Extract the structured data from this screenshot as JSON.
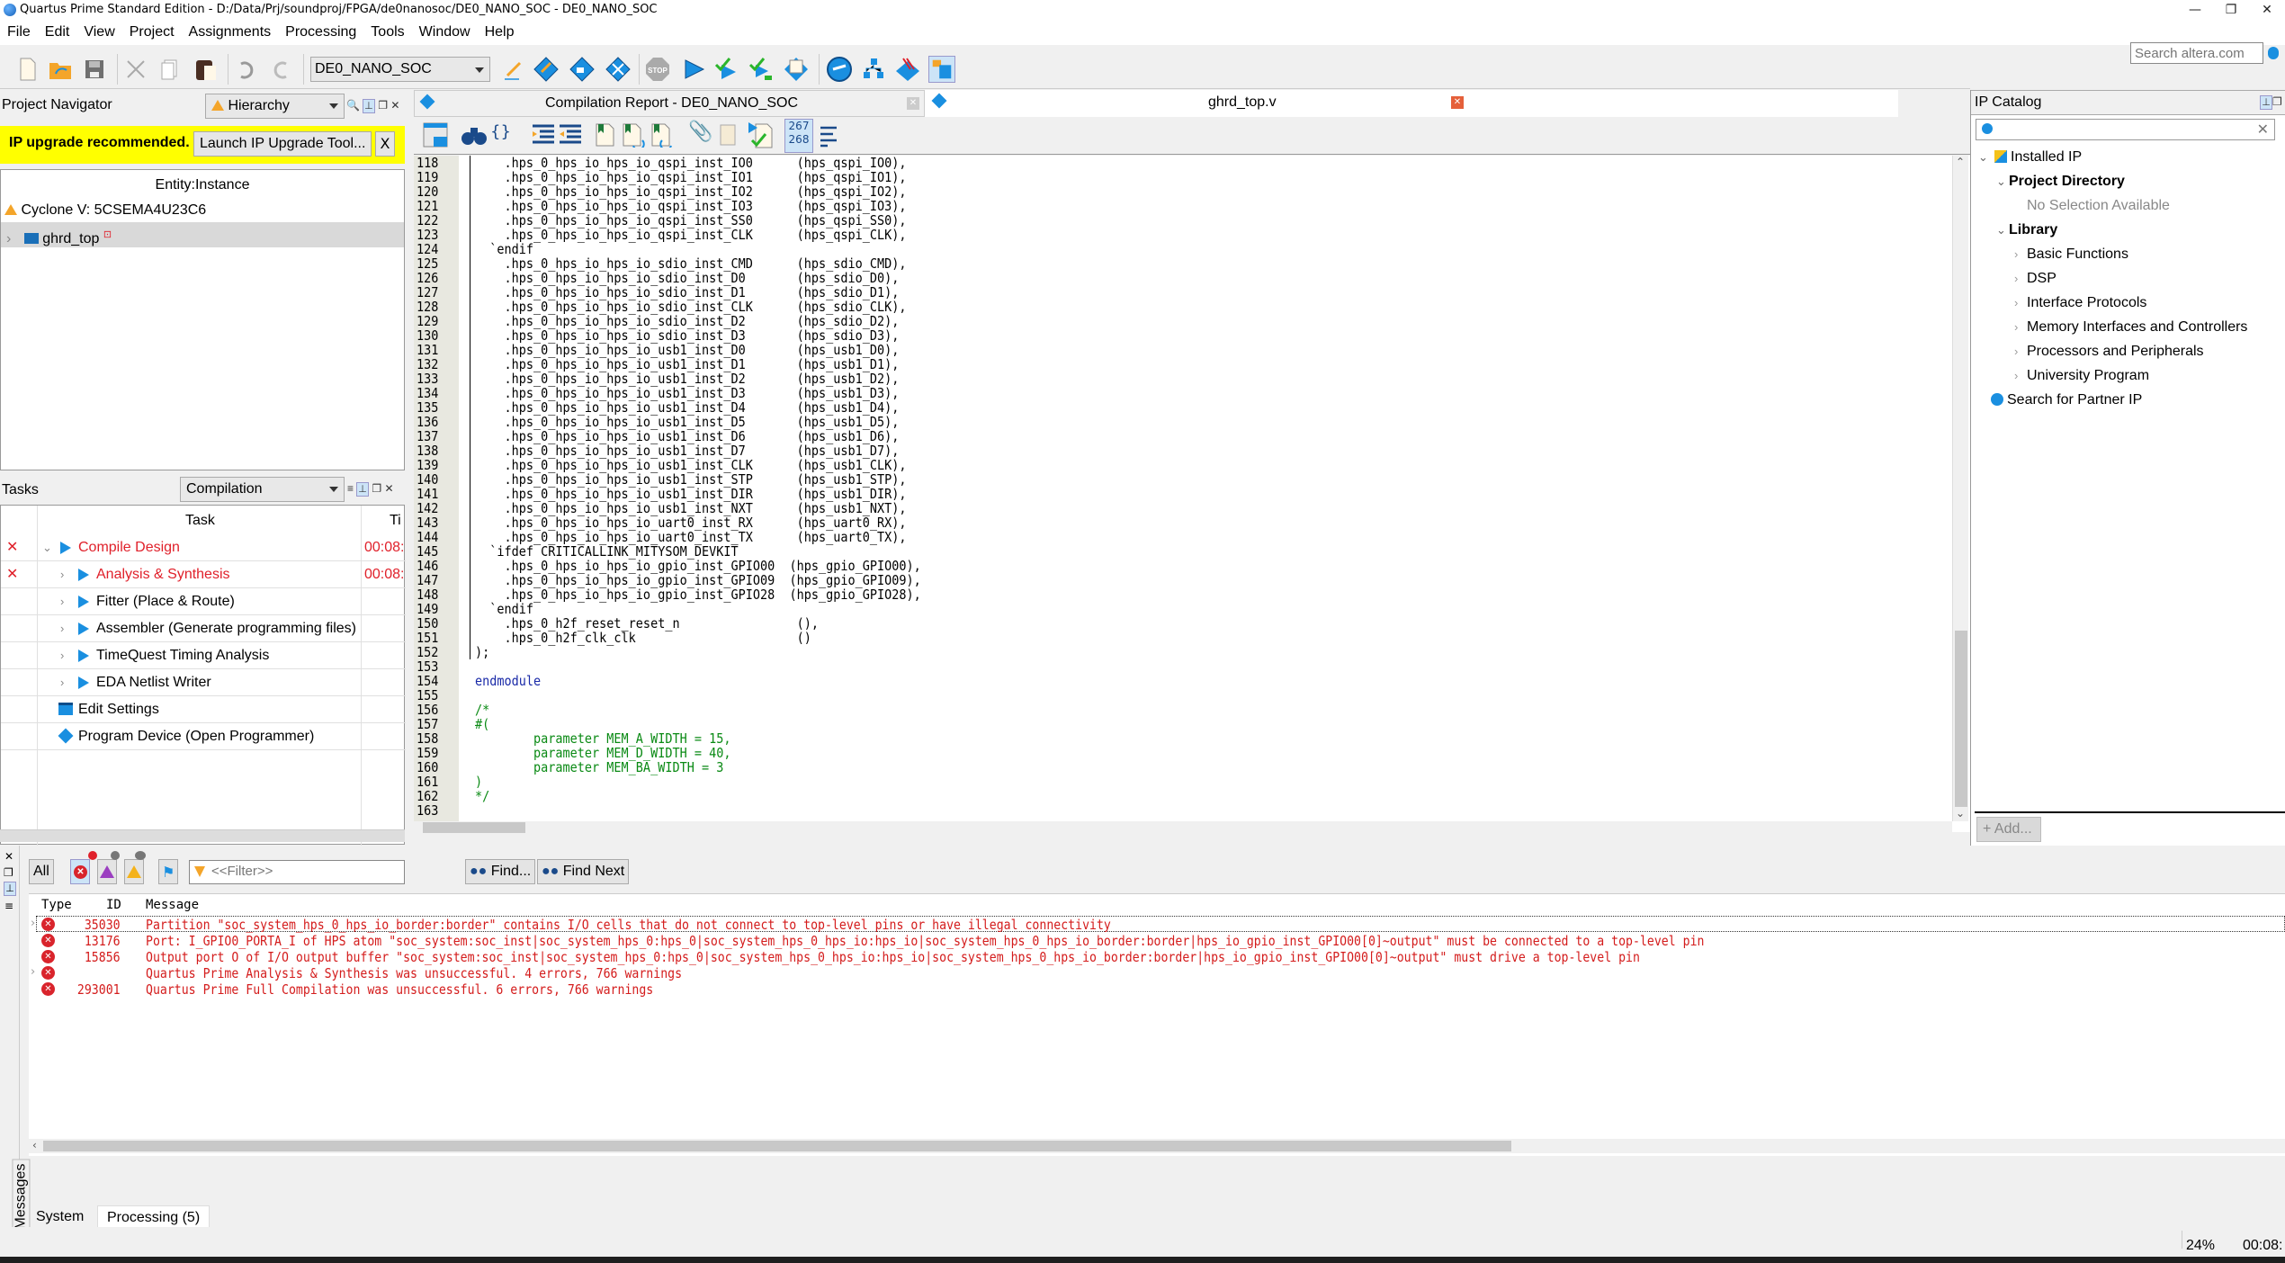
{
  "window": {
    "title": "Quartus Prime Standard Edition - D:/Data/Prj/soundproj/FPGA/de0nanosoc/DE0_NANO_SOC - DE0_NANO_SOC",
    "minimize": "—",
    "restore": "❐",
    "close": "✕"
  },
  "menu": [
    "File",
    "Edit",
    "View",
    "Project",
    "Assignments",
    "Processing",
    "Tools",
    "Window",
    "Help"
  ],
  "search_altera": {
    "placeholder": "Search altera.com"
  },
  "toolbar": {
    "project_selector": "DE0_NANO_SOC",
    "stop_label": "STOP",
    "line_counter_top": "267",
    "line_counter_bottom": "268"
  },
  "project_navigator": {
    "title": "Project Navigator",
    "view": "Hierarchy",
    "ip_banner": {
      "text": "IP upgrade recommended.",
      "button": "Launch IP Upgrade Tool...",
      "dismiss": "X"
    },
    "column_header": "Entity:Instance",
    "device": "Cyclone V: 5CSEMA4U23C6",
    "top_entity": "ghrd_top"
  },
  "tasks": {
    "title": "Tasks",
    "flow": "Compilation",
    "column_task": "Task",
    "column_time": "Ti",
    "items": [
      {
        "label": "Compile Design",
        "status": "error",
        "time": "00:08:",
        "level": 0,
        "expanded": true,
        "icon": "play-icon"
      },
      {
        "label": "Analysis & Synthesis",
        "status": "error",
        "time": "00:08:",
        "level": 1,
        "expanded": false,
        "icon": "play-icon"
      },
      {
        "label": "Fitter (Place & Route)",
        "status": "",
        "time": "",
        "level": 1,
        "expanded": false,
        "icon": "play-icon"
      },
      {
        "label": "Assembler (Generate programming files)",
        "status": "",
        "time": "",
        "level": 1,
        "expanded": false,
        "icon": "play-icon"
      },
      {
        "label": "TimeQuest Timing Analysis",
        "status": "",
        "time": "",
        "level": 1,
        "expanded": false,
        "icon": "play-icon"
      },
      {
        "label": "EDA Netlist Writer",
        "status": "",
        "time": "",
        "level": 1,
        "expanded": false,
        "icon": "play-icon"
      },
      {
        "label": "Edit Settings",
        "status": "",
        "time": "",
        "level": 0,
        "icon": "settings-icon"
      },
      {
        "label": "Program Device (Open Programmer)",
        "status": "",
        "time": "",
        "level": 0,
        "icon": "programmer-icon"
      }
    ]
  },
  "editor_tabs": [
    {
      "label": "Compilation Report - DE0_NANO_SOC",
      "active": false
    },
    {
      "label": "ghrd_top.v",
      "active": true
    }
  ],
  "code": {
    "lines": [
      {
        "n": "118",
        "t": "    .hps_0_hps_io_hps_io_qspi_inst_IO0      (hps_qspi_IO0),",
        "c": ""
      },
      {
        "n": "119",
        "t": "    .hps_0_hps_io_hps_io_qspi_inst_IO1      (hps_qspi_IO1),",
        "c": ""
      },
      {
        "n": "120",
        "t": "    .hps_0_hps_io_hps_io_qspi_inst_IO2      (hps_qspi_IO2),",
        "c": ""
      },
      {
        "n": "121",
        "t": "    .hps_0_hps_io_hps_io_qspi_inst_IO3      (hps_qspi_IO3),",
        "c": ""
      },
      {
        "n": "122",
        "t": "    .hps_0_hps_io_hps_io_qspi_inst_SS0      (hps_qspi_SS0),",
        "c": ""
      },
      {
        "n": "123",
        "t": "    .hps_0_hps_io_hps_io_qspi_inst_CLK      (hps_qspi_CLK),",
        "c": ""
      },
      {
        "n": "124",
        "t": "  `endif",
        "c": ""
      },
      {
        "n": "125",
        "t": "    .hps_0_hps_io_hps_io_sdio_inst_CMD      (hps_sdio_CMD),",
        "c": ""
      },
      {
        "n": "126",
        "t": "    .hps_0_hps_io_hps_io_sdio_inst_D0       (hps_sdio_D0),",
        "c": ""
      },
      {
        "n": "127",
        "t": "    .hps_0_hps_io_hps_io_sdio_inst_D1       (hps_sdio_D1),",
        "c": ""
      },
      {
        "n": "128",
        "t": "    .hps_0_hps_io_hps_io_sdio_inst_CLK      (hps_sdio_CLK),",
        "c": ""
      },
      {
        "n": "129",
        "t": "    .hps_0_hps_io_hps_io_sdio_inst_D2       (hps_sdio_D2),",
        "c": ""
      },
      {
        "n": "130",
        "t": "    .hps_0_hps_io_hps_io_sdio_inst_D3       (hps_sdio_D3),",
        "c": ""
      },
      {
        "n": "131",
        "t": "    .hps_0_hps_io_hps_io_usb1_inst_D0       (hps_usb1_D0),",
        "c": ""
      },
      {
        "n": "132",
        "t": "    .hps_0_hps_io_hps_io_usb1_inst_D1       (hps_usb1_D1),",
        "c": ""
      },
      {
        "n": "133",
        "t": "    .hps_0_hps_io_hps_io_usb1_inst_D2       (hps_usb1_D2),",
        "c": ""
      },
      {
        "n": "134",
        "t": "    .hps_0_hps_io_hps_io_usb1_inst_D3       (hps_usb1_D3),",
        "c": ""
      },
      {
        "n": "135",
        "t": "    .hps_0_hps_io_hps_io_usb1_inst_D4       (hps_usb1_D4),",
        "c": ""
      },
      {
        "n": "136",
        "t": "    .hps_0_hps_io_hps_io_usb1_inst_D5       (hps_usb1_D5),",
        "c": ""
      },
      {
        "n": "137",
        "t": "    .hps_0_hps_io_hps_io_usb1_inst_D6       (hps_usb1_D6),",
        "c": ""
      },
      {
        "n": "138",
        "t": "    .hps_0_hps_io_hps_io_usb1_inst_D7       (hps_usb1_D7),",
        "c": ""
      },
      {
        "n": "139",
        "t": "    .hps_0_hps_io_hps_io_usb1_inst_CLK      (hps_usb1_CLK),",
        "c": ""
      },
      {
        "n": "140",
        "t": "    .hps_0_hps_io_hps_io_usb1_inst_STP      (hps_usb1_STP),",
        "c": ""
      },
      {
        "n": "141",
        "t": "    .hps_0_hps_io_hps_io_usb1_inst_DIR      (hps_usb1_DIR),",
        "c": ""
      },
      {
        "n": "142",
        "t": "    .hps_0_hps_io_hps_io_usb1_inst_NXT      (hps_usb1_NXT),",
        "c": ""
      },
      {
        "n": "143",
        "t": "    .hps_0_hps_io_hps_io_uart0_inst_RX      (hps_uart0_RX),",
        "c": ""
      },
      {
        "n": "144",
        "t": "    .hps_0_hps_io_hps_io_uart0_inst_TX      (hps_uart0_TX),",
        "c": ""
      },
      {
        "n": "145",
        "t": "  `ifdef CRITICALLINK_MITYSOM_DEVKIT",
        "c": ""
      },
      {
        "n": "146",
        "t": "    .hps_0_hps_io_hps_io_gpio_inst_GPIO00  (hps_gpio_GPIO00),",
        "c": ""
      },
      {
        "n": "147",
        "t": "    .hps_0_hps_io_hps_io_gpio_inst_GPIO09  (hps_gpio_GPIO09),",
        "c": ""
      },
      {
        "n": "148",
        "t": "    .hps_0_hps_io_hps_io_gpio_inst_GPIO28  (hps_gpio_GPIO28),",
        "c": ""
      },
      {
        "n": "149",
        "t": "  `endif",
        "c": ""
      },
      {
        "n": "150",
        "t": "    .hps_0_h2f_reset_reset_n                (),",
        "c": ""
      },
      {
        "n": "151",
        "t": "    .hps_0_h2f_clk_clk                      ()",
        "c": ""
      },
      {
        "n": "152",
        "t": ");",
        "c": ""
      },
      {
        "n": "153",
        "t": "",
        "c": ""
      },
      {
        "n": "154",
        "t": "endmodule",
        "c": "kw"
      },
      {
        "n": "155",
        "t": "",
        "c": ""
      },
      {
        "n": "156",
        "t": "/*",
        "c": "cmt"
      },
      {
        "n": "157",
        "t": "#(",
        "c": "cmt"
      },
      {
        "n": "158",
        "t": "        parameter MEM_A_WIDTH = 15,",
        "c": "cmt"
      },
      {
        "n": "159",
        "t": "        parameter MEM_D_WIDTH = 40,",
        "c": "cmt"
      },
      {
        "n": "160",
        "t": "        parameter MEM_BA_WIDTH = 3",
        "c": "cmt"
      },
      {
        "n": "161",
        "t": ")",
        "c": "cmt"
      },
      {
        "n": "162",
        "t": "*/",
        "c": "cmt"
      },
      {
        "n": "163",
        "t": "",
        "c": ""
      }
    ]
  },
  "ip_catalog": {
    "title": "IP Catalog",
    "search_value": "",
    "tree": [
      {
        "label": "Installed IP",
        "level": 0,
        "chev": "v",
        "bold": false,
        "icon": "installed-ip-icon"
      },
      {
        "label": "Project Directory",
        "level": 1,
        "chev": "v",
        "bold": true
      },
      {
        "label": "No Selection Available",
        "level": 2,
        "chev": "",
        "bold": false,
        "muted": true
      },
      {
        "label": "Library",
        "level": 1,
        "chev": "v",
        "bold": true
      },
      {
        "label": "Basic Functions",
        "level": 2,
        "chev": ">",
        "bold": false
      },
      {
        "label": "DSP",
        "level": 2,
        "chev": ">",
        "bold": false
      },
      {
        "label": "Interface Protocols",
        "level": 2,
        "chev": ">",
        "bold": false
      },
      {
        "label": "Memory Interfaces and Controllers",
        "level": 2,
        "chev": ">",
        "bold": false
      },
      {
        "label": "Processors and Peripherals",
        "level": 2,
        "chev": ">",
        "bold": false
      },
      {
        "label": "University Program",
        "level": 2,
        "chev": ">",
        "bold": false
      },
      {
        "label": "Search for Partner IP",
        "level": 0,
        "chev": "",
        "bold": false,
        "icon": "globe-icon"
      }
    ],
    "add_button": "+ Add..."
  },
  "messages": {
    "panel_label": "Messages",
    "filter_all": "All",
    "filter_placeholder": "<<Filter>>",
    "find": "Find...",
    "find_next": "Find Next",
    "columns": {
      "type": "Type",
      "id": "ID",
      "message": "Message"
    },
    "rows": [
      {
        "expandable": true,
        "type": "error",
        "id": "35030",
        "text": "Partition \"soc_system_hps_0_hps_io_border:border\" contains I/O cells that do not connect to top-level pins or have illegal connectivity"
      },
      {
        "expandable": false,
        "type": "error",
        "id": "13176",
        "text": "Port: I_GPIO0_PORTA_I of HPS atom \"soc_system:soc_inst|soc_system_hps_0:hps_0|soc_system_hps_0_hps_io:hps_io|soc_system_hps_0_hps_io_border:border|hps_io_gpio_inst_GPIO00[0]~output\" must be connected to a top-level pin"
      },
      {
        "expandable": false,
        "type": "error",
        "id": "15856",
        "text": "Output port O of I/O output buffer \"soc_system:soc_inst|soc_system_hps_0:hps_0|soc_system_hps_0_hps_io:hps_io|soc_system_hps_0_hps_io_border:border|hps_io_gpio_inst_GPIO00[0]~output\" must drive a top-level pin"
      },
      {
        "expandable": true,
        "type": "error",
        "id": "",
        "text": "Quartus Prime Analysis & Synthesis was unsuccessful. 4 errors, 766 warnings"
      },
      {
        "expandable": false,
        "type": "error",
        "id": "293001",
        "text": "Quartus Prime Full Compilation was unsuccessful. 6 errors, 766 warnings"
      }
    ],
    "tabs": [
      {
        "label": "System",
        "active": false
      },
      {
        "label": "Processing (5)",
        "active": true
      }
    ]
  },
  "status": {
    "progress": "24%",
    "elapsed": "00:08:"
  },
  "colors": {
    "error": "#d41c1c",
    "accent": "#1a8fe0",
    "banner": "#ffff00"
  }
}
